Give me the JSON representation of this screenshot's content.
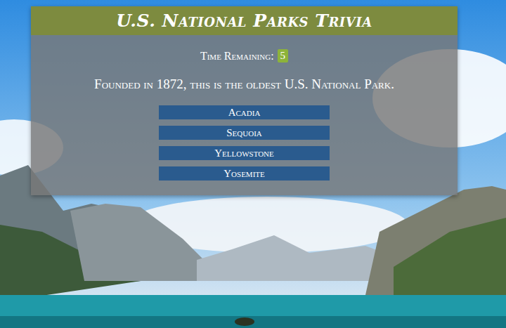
{
  "header": {
    "title": "U.S. National Parks Trivia"
  },
  "timer": {
    "label": "Time Remaining:",
    "value": "5"
  },
  "question": {
    "text": "Founded in 1872, this is the oldest U.S. National Park."
  },
  "answers": [
    {
      "label": "Acadia"
    },
    {
      "label": "Sequoia"
    },
    {
      "label": "Yellowstone"
    },
    {
      "label": "Yosemite"
    }
  ]
}
